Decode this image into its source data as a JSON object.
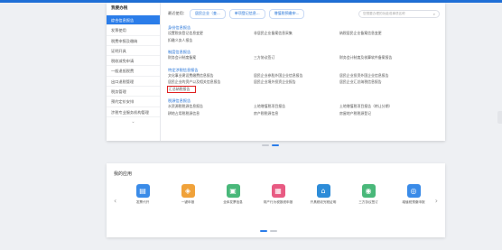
{
  "sidebar": {
    "title": "我要办税",
    "items": [
      {
        "label": "综合信息报告",
        "active": true
      },
      {
        "label": "发票使用"
      },
      {
        "label": "税费申报及缴纳"
      },
      {
        "label": "证明开具"
      },
      {
        "label": "税收减免申请"
      },
      {
        "label": "一般退抵税费"
      },
      {
        "label": "出口退税管理"
      },
      {
        "label": "税务管理"
      },
      {
        "label": "预约定价安排"
      },
      {
        "label": "涉税专业服务机构管理"
      }
    ],
    "more": "⌄"
  },
  "common": {
    "label": "最近使用：",
    "pills": [
      "居民企业（查...",
      "单项登记信息...",
      "增值税预缴申..."
    ],
    "search_placeholder": "您想要办理的功能或事项名称"
  },
  "sections": [
    {
      "title": "身份信息报告",
      "links": [
        "设置税务登记信息变更",
        "非居民企业备案信息采集",
        "纳税居民企业备案信息变更",
        "扣缴义务人报告"
      ]
    },
    {
      "title": "制度信息报告",
      "links": [
        "财务会计制度备案",
        "三方协议签订",
        "财务会计制度及核算软件备案报告"
      ]
    },
    {
      "title": "特定涉税信息报告",
      "links": [
        "文化事业建设费缴费信息报告",
        "居民企业参股外国企业信息报告",
        "居民企业投资外国企业信息报告",
        "居民企业的资产以及相关信息报告",
        "居民企业境外投资企业报告",
        "居民企业汇总纳税信息报告",
        "汇总纳税报告"
      ],
      "highlight_index": 6
    },
    {
      "title": "税源信息报告",
      "links": [
        "水资源税税源信息报告",
        "土地增值税项目报告",
        "土地增值税项目报告（转让分期）",
        "耕地占用税税源信息",
        "房产税税源信息",
        "房屋地产税税源登记"
      ]
    }
  ],
  "apps_panel": {
    "title": "我的应用",
    "arrow_left": "‹",
    "arrow_right": "›",
    "apps": [
      {
        "label": "发票代开",
        "color": "#3a8be8",
        "glyph": "▤"
      },
      {
        "label": "一键申报",
        "color": "#f0a23a",
        "glyph": "◈"
      },
      {
        "label": "全体发票信息",
        "color": "#49b87a",
        "glyph": "▣"
      },
      {
        "label": "财产行为税报税申报",
        "color": "#e85a82",
        "glyph": "▦"
      },
      {
        "label": "开具税收完税证明",
        "color": "#2d8cd8",
        "glyph": "⌂"
      },
      {
        "label": "三方协议签订",
        "color": "#49b87a",
        "glyph": "◉"
      },
      {
        "label": "增值税预缴申报",
        "color": "#3a8be8",
        "glyph": "◎"
      }
    ]
  },
  "colors": {
    "accent": "#1f6fd6",
    "active_bg": "#2b7de9",
    "highlight": "#e02020"
  }
}
